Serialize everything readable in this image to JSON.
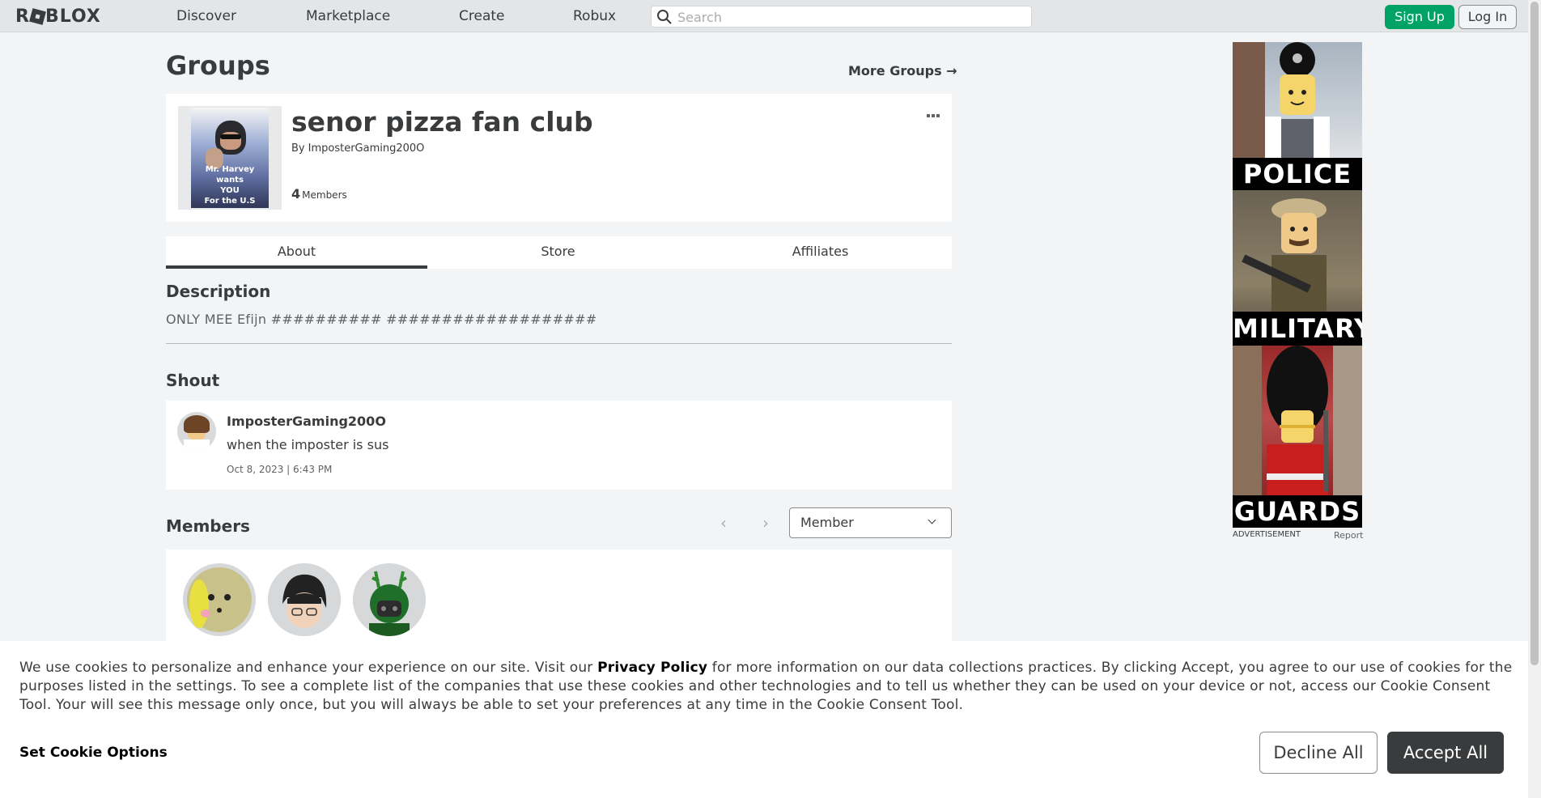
{
  "nav": {
    "logo": "ROBLOX",
    "links": [
      "Discover",
      "Marketplace",
      "Create",
      "Robux"
    ],
    "search_placeholder": "Search",
    "signup": "Sign Up",
    "login": "Log In"
  },
  "page": {
    "title": "Groups",
    "more_groups": "More Groups →"
  },
  "group": {
    "name": "senor pizza fan club",
    "by_label": "By",
    "owner": "ImposterGaming200O",
    "member_count": "4",
    "members_label": "Members",
    "emblem_text": [
      "Mr. Harvey wants",
      "YOU",
      "For the U.S Army"
    ]
  },
  "tabs": [
    "About",
    "Store",
    "Affiliates"
  ],
  "description": {
    "heading": "Description",
    "text": "ONLY MEE Efijn ########## ###################"
  },
  "shout": {
    "heading": "Shout",
    "user": "ImposterGaming200O",
    "message": "when the imposter is sus",
    "date": "Oct 8, 2023 | 6:43 PM"
  },
  "members": {
    "heading": "Members",
    "role_selected": "Member"
  },
  "ad": {
    "panels": [
      "POLICE",
      "MILITARY",
      "GUARDS"
    ],
    "label": "ADVERTISEMENT",
    "report": "Report"
  },
  "cookie": {
    "text_before": "We use cookies to personalize and enhance your experience on our site. Visit our ",
    "privacy_link": "Privacy Policy",
    "text_after": " for more information on our data collections practices. By clicking Accept, you agree to our use of cookies for the purposes listed in the settings. To see a complete list of the companies that use these cookies and other technologies and to tell us whether they can be used on your device or not, access our Cookie Consent Tool. Your will see this message only once, but you will always be able to set your preferences at any time in the Cookie Consent Tool.",
    "options": "Set Cookie Options",
    "decline": "Decline All",
    "accept": "Accept All"
  },
  "colors": {
    "signup_green": "#00a266",
    "accept_dark": "#393b3d",
    "nav_bg": "#e3e5e7",
    "page_bg": "#f2f4f5"
  }
}
